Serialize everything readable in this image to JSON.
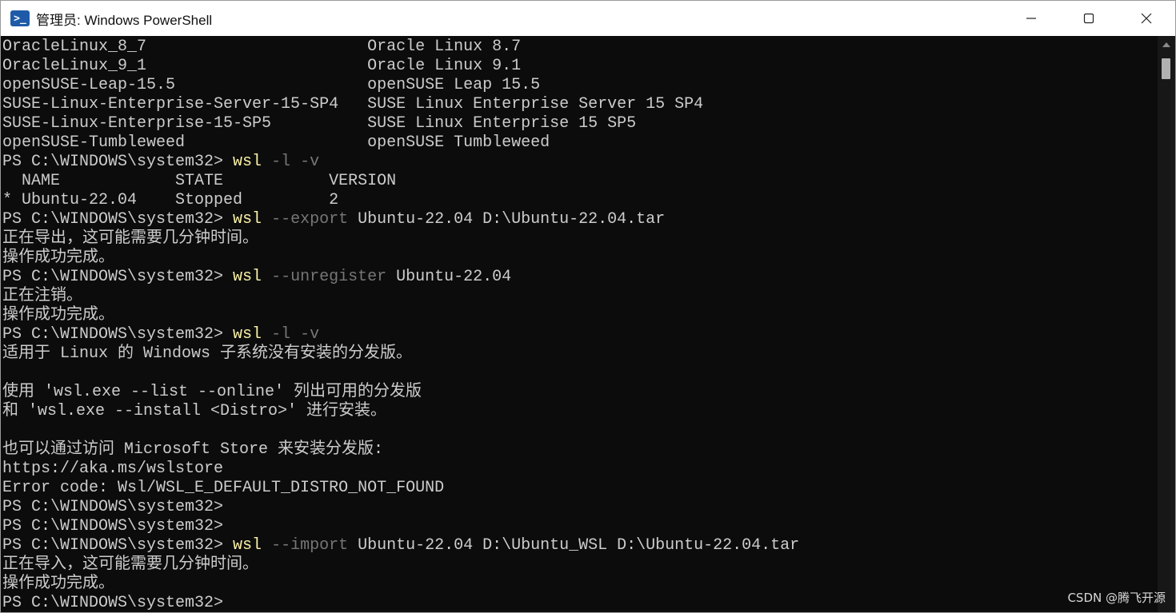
{
  "window": {
    "title": "管理员: Windows PowerShell",
    "icon": "powershell-icon",
    "controls": {
      "minimize": "minimize-icon",
      "maximize": "maximize-icon",
      "close": "close-icon"
    }
  },
  "colors": {
    "background": "#0c0c0c",
    "text": "#cccccc",
    "command": "#f9f1a5",
    "parameter": "#767676",
    "titlebar": "#ffffff"
  },
  "console": {
    "lines": [
      [
        {
          "text": "OracleLinux_8_7                       Oracle Linux 8.7",
          "style": "plain"
        }
      ],
      [
        {
          "text": "OracleLinux_9_1                       Oracle Linux 9.1",
          "style": "plain"
        }
      ],
      [
        {
          "text": "openSUSE-Leap-15.5                    openSUSE Leap 15.5",
          "style": "plain"
        }
      ],
      [
        {
          "text": "SUSE-Linux-Enterprise-Server-15-SP4   SUSE Linux Enterprise Server 15 SP4",
          "style": "plain"
        }
      ],
      [
        {
          "text": "SUSE-Linux-Enterprise-15-SP5          SUSE Linux Enterprise 15 SP5",
          "style": "plain"
        }
      ],
      [
        {
          "text": "openSUSE-Tumbleweed                   openSUSE Tumbleweed",
          "style": "plain"
        }
      ],
      [
        {
          "text": "PS C:\\WINDOWS\\system32> ",
          "style": "plain"
        },
        {
          "text": "wsl",
          "style": "cmd"
        },
        {
          "text": " -l -v",
          "style": "param"
        }
      ],
      [
        {
          "text": "  NAME            STATE           VERSION",
          "style": "plain"
        }
      ],
      [
        {
          "text": "* Ubuntu-22.04    Stopped         2",
          "style": "plain"
        }
      ],
      [
        {
          "text": "PS C:\\WINDOWS\\system32> ",
          "style": "plain"
        },
        {
          "text": "wsl",
          "style": "cmd"
        },
        {
          "text": " --export",
          "style": "param"
        },
        {
          "text": " Ubuntu-22.04 D:\\Ubuntu-22.04.tar",
          "style": "plain"
        }
      ],
      [
        {
          "text": "正在导出，这可能需要几分钟时间。",
          "style": "plain"
        }
      ],
      [
        {
          "text": "操作成功完成。",
          "style": "plain"
        }
      ],
      [
        {
          "text": "PS C:\\WINDOWS\\system32> ",
          "style": "plain"
        },
        {
          "text": "wsl",
          "style": "cmd"
        },
        {
          "text": " --unregister",
          "style": "param"
        },
        {
          "text": " Ubuntu-22.04",
          "style": "plain"
        }
      ],
      [
        {
          "text": "正在注销。",
          "style": "plain"
        }
      ],
      [
        {
          "text": "操作成功完成。",
          "style": "plain"
        }
      ],
      [
        {
          "text": "PS C:\\WINDOWS\\system32> ",
          "style": "plain"
        },
        {
          "text": "wsl",
          "style": "cmd"
        },
        {
          "text": " -l -v",
          "style": "param"
        }
      ],
      [
        {
          "text": "适用于 Linux 的 Windows 子系统没有安装的分发版。",
          "style": "plain"
        }
      ],
      [
        {
          "text": "",
          "style": "plain"
        }
      ],
      [
        {
          "text": "使用 'wsl.exe --list --online' 列出可用的分发版",
          "style": "plain"
        }
      ],
      [
        {
          "text": "和 'wsl.exe --install <Distro>' 进行安装。",
          "style": "plain"
        }
      ],
      [
        {
          "text": "",
          "style": "plain"
        }
      ],
      [
        {
          "text": "也可以通过访问 Microsoft Store 来安装分发版:",
          "style": "plain"
        }
      ],
      [
        {
          "text": "https://aka.ms/wslstore",
          "style": "plain"
        }
      ],
      [
        {
          "text": "Error code: Wsl/WSL_E_DEFAULT_DISTRO_NOT_FOUND",
          "style": "plain"
        }
      ],
      [
        {
          "text": "PS C:\\WINDOWS\\system32>",
          "style": "plain"
        }
      ],
      [
        {
          "text": "PS C:\\WINDOWS\\system32>",
          "style": "plain"
        }
      ],
      [
        {
          "text": "PS C:\\WINDOWS\\system32> ",
          "style": "plain"
        },
        {
          "text": "wsl",
          "style": "cmd"
        },
        {
          "text": " --import",
          "style": "param"
        },
        {
          "text": " Ubuntu-22.04 D:\\Ubuntu_WSL D:\\Ubuntu-22.04.tar",
          "style": "plain"
        }
      ],
      [
        {
          "text": "正在导入，这可能需要几分钟时间。",
          "style": "plain"
        }
      ],
      [
        {
          "text": "操作成功完成。",
          "style": "plain"
        }
      ],
      [
        {
          "text": "PS C:\\WINDOWS\\system32>",
          "style": "plain"
        }
      ]
    ]
  },
  "watermark": "CSDN @腾飞开源"
}
